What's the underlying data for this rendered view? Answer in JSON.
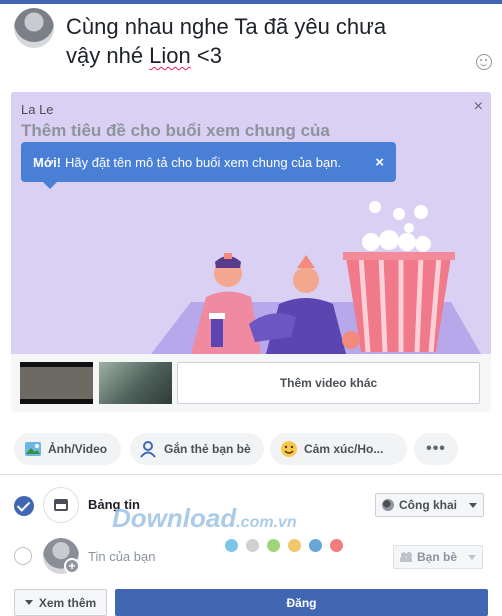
{
  "composer": {
    "text_main": "Cùng nhau nghe Ta đã yêu chưa",
    "text_line2_pre": "vậy nhé ",
    "text_line2_name": "Lion",
    "text_line2_post": " <3"
  },
  "watch_party": {
    "host": "La Le",
    "title_placeholder": "Thêm tiêu đề cho buổi xem chung của",
    "close_icon": "×",
    "tooltip": {
      "bold": "Mới!",
      "text": "Hãy đặt tên mô tả cho buổi xem chung của bạn.",
      "close": "×"
    },
    "add_video_label": "Thêm video khác"
  },
  "actions": [
    {
      "label": "Ảnh/Video",
      "icon": "photo-icon"
    },
    {
      "label": "Gắn thẻ bạn bè",
      "icon": "tag-friends-icon"
    },
    {
      "label": "Cảm xúc/Ho...",
      "icon": "feeling-icon"
    },
    {
      "label": "•••",
      "icon": "more-icon"
    }
  ],
  "destinations": {
    "feed_label": "Bảng tin",
    "feed_privacy": "Công khai",
    "story_label": "Tin của bạn",
    "story_privacy": "Bạn bè"
  },
  "watermark": {
    "main": "Download",
    "suffix": ".com.vn"
  },
  "story_colors": [
    "#7cc6ea",
    "#cfd0d2",
    "#9fd37c",
    "#f4c76d",
    "#66a6d9",
    "#f07e7e"
  ],
  "footer": {
    "more_label": "Xem thêm",
    "post_label": "Đăng"
  },
  "colors": {
    "brand": "#4267b2",
    "tooltip": "#4a7fd6",
    "illustration_bg": "#d9d0f3"
  }
}
